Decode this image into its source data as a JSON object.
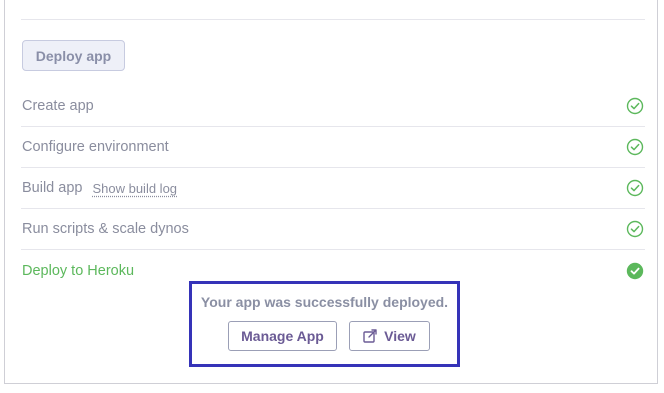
{
  "deploy": {
    "button_label": "Deploy app"
  },
  "steps": [
    {
      "label": "Create app",
      "status": "complete",
      "icon": "check-circle-outline-icon"
    },
    {
      "label": "Configure environment",
      "status": "complete",
      "icon": "check-circle-outline-icon"
    },
    {
      "label": "Build app",
      "link": "Show build log",
      "status": "complete",
      "icon": "check-circle-outline-icon"
    },
    {
      "label": "Run scripts & scale dynos",
      "status": "complete",
      "icon": "check-circle-outline-icon"
    },
    {
      "label": "Deploy to Heroku",
      "status": "success",
      "icon": "check-circle-filled-icon"
    }
  ],
  "result": {
    "message": "Your app was successfully deployed.",
    "manage_label": "Manage App",
    "view_label": "View",
    "view_icon": "external-link-icon"
  },
  "colors": {
    "success": "#5cb85c",
    "highlight_border": "#3533b8",
    "button_text": "#6b5b95"
  }
}
